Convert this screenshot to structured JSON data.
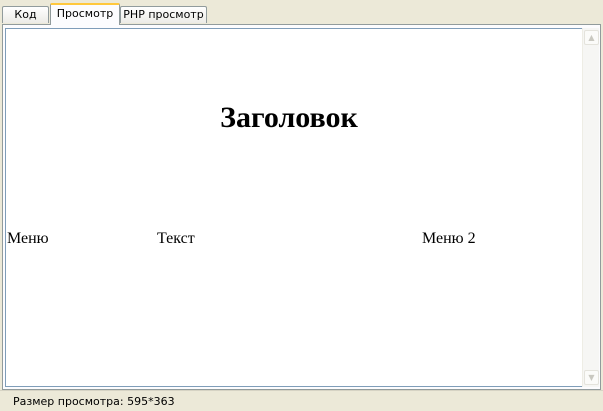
{
  "tabs": [
    {
      "label": "Код",
      "active": false
    },
    {
      "label": "Просмотр",
      "active": true
    },
    {
      "label": "PHP просмотр",
      "active": false
    }
  ],
  "preview": {
    "heading": "Заголовок",
    "columns": [
      "Меню",
      "Текст",
      "Меню 2"
    ]
  },
  "scrollbar": {
    "up_icon": "chevron-up-icon",
    "down_icon": "chevron-down-icon"
  },
  "status": {
    "text": "Размер просмотра: 595*363"
  },
  "colors": {
    "tab_highlight": "#ffc83c",
    "window_bg": "#ece9d8",
    "border": "#919b9c"
  }
}
